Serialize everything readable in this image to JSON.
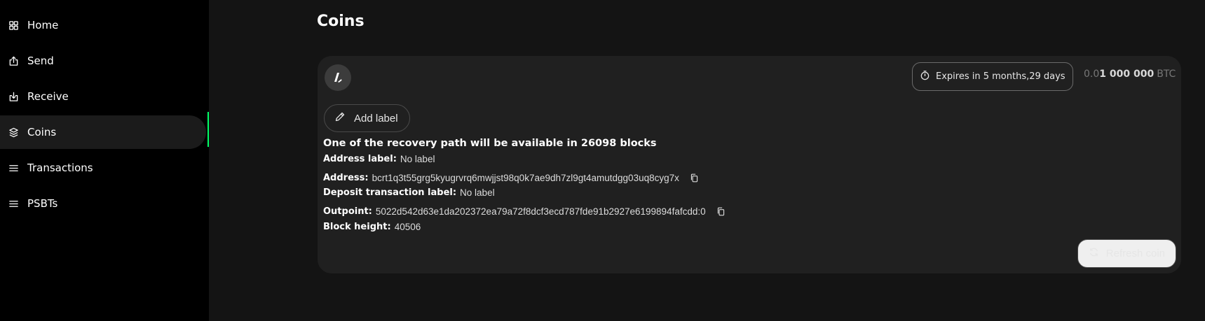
{
  "sidebar": {
    "items": [
      {
        "label": "Home",
        "icon": "grid-icon",
        "active": false
      },
      {
        "label": "Send",
        "icon": "send-icon",
        "active": false
      },
      {
        "label": "Receive",
        "icon": "receive-icon",
        "active": false
      },
      {
        "label": "Coins",
        "icon": "coins-icon",
        "active": true
      },
      {
        "label": "Transactions",
        "icon": "list-icon",
        "active": false
      },
      {
        "label": "PSBTs",
        "icon": "list-icon",
        "active": false
      }
    ],
    "accent_color": "#00ff66"
  },
  "main": {
    "title": "Coins",
    "coin": {
      "expiry": "Expires in 5 months,29 days",
      "amount_dim": "0.0",
      "amount_strong": "1 000 000",
      "amount_unit": "BTC",
      "add_label": "Add label",
      "recovery_message": "One of the recovery path will be available in 26098 blocks",
      "details": {
        "address_label_key": "Address label:",
        "address_label_value": "No label",
        "address_key": "Address:",
        "address_value": "bcrt1q3t55grg5kyugrvrq6mwjjst98q0k7ae9dh7zl9gt4amutdgg03uq8cyg7x",
        "deposit_label_key": "Deposit transaction label:",
        "deposit_label_value": "No label",
        "outpoint_key": "Outpoint:",
        "outpoint_value": "5022d542d63e1da202372ea79a72f8dcf3ecd787fde91b2927e6199894fafcdd:0",
        "block_height_key": "Block height:",
        "block_height_value": "40506"
      },
      "refresh_label": "Refresh coin"
    }
  }
}
